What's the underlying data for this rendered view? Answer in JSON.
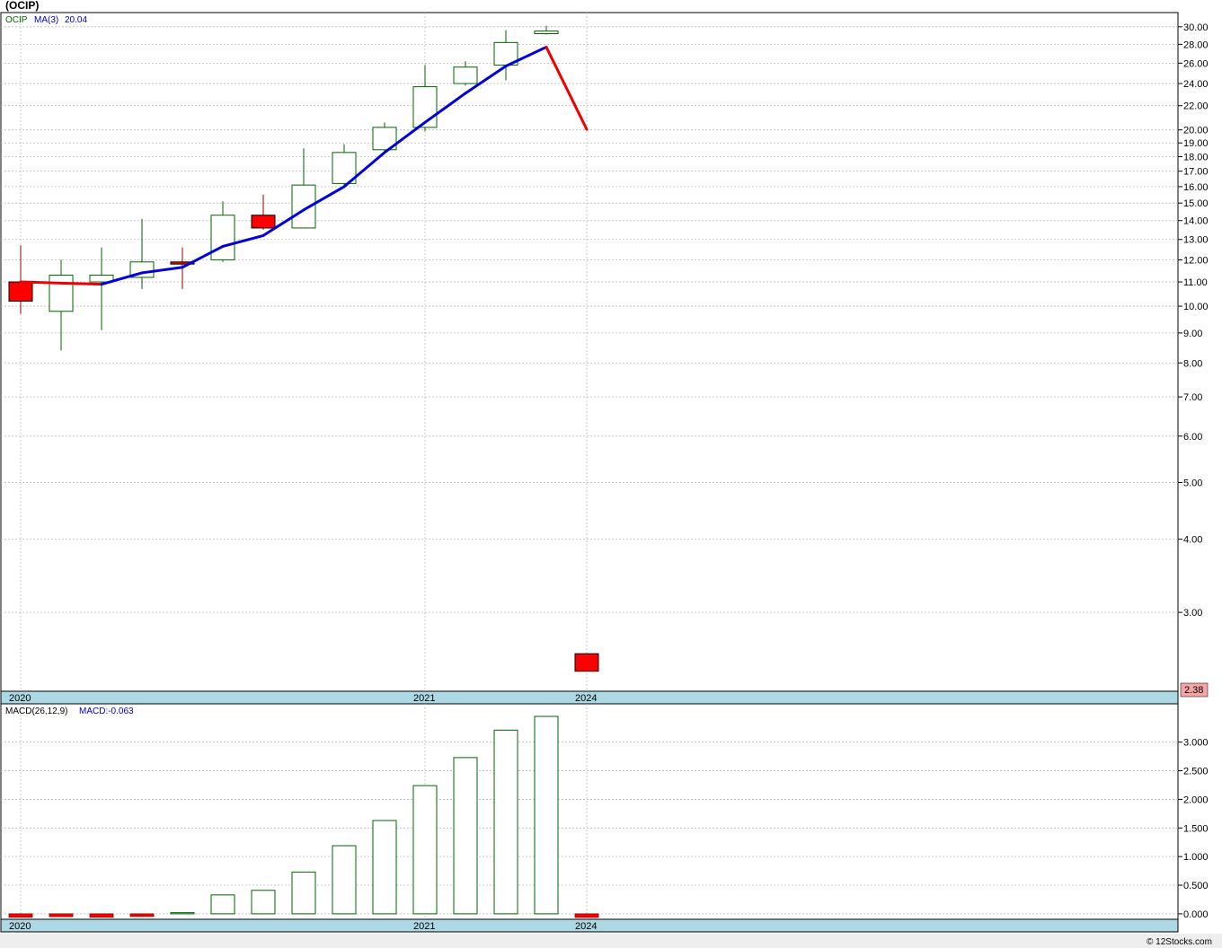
{
  "header": {
    "symbol_title": "(OCIP)"
  },
  "footer": {
    "watermark": "© 12Stocks.com"
  },
  "colors": {
    "up_border": "#006400",
    "down_fill": "#ff0000",
    "ma_up": "#0000dd",
    "ma_down": "#ee0000",
    "axis_band": "#add8e6",
    "grid": "#bbbbbb"
  },
  "chart_data": [
    {
      "type": "candlestick",
      "legend": {
        "symbol": "OCIP",
        "ma_label": "MA(3)",
        "ma_value": "20.04"
      },
      "scale": "log",
      "ylim": [
        2.2,
        31.5
      ],
      "y_ticks": [
        "30.00",
        "28.00",
        "26.00",
        "24.00",
        "22.00",
        "20.00",
        "19.00",
        "18.00",
        "17.00",
        "16.00",
        "15.00",
        "14.00",
        "13.00",
        "12.00",
        "11.00",
        "10.00",
        "9.00",
        "8.00",
        "7.00",
        "6.00",
        "5.00",
        "4.00",
        "3.00"
      ],
      "x_labels": [
        {
          "label": "2020",
          "index": 0
        },
        {
          "label": "2021",
          "index": 10
        },
        {
          "label": "2024",
          "index": 14
        }
      ],
      "last_price": "2.38",
      "candles": [
        {
          "o": 11.0,
          "h": 12.7,
          "l": 9.7,
          "c": 10.2
        },
        {
          "o": 9.8,
          "h": 12.0,
          "l": 8.4,
          "c": 11.3
        },
        {
          "o": 11.0,
          "h": 12.6,
          "l": 9.1,
          "c": 11.3
        },
        {
          "o": 11.2,
          "h": 14.1,
          "l": 10.7,
          "c": 11.9
        },
        {
          "o": 11.9,
          "h": 12.6,
          "l": 10.7,
          "c": 11.8
        },
        {
          "o": 12.0,
          "h": 15.1,
          "l": 11.9,
          "c": 14.3
        },
        {
          "o": 14.3,
          "h": 15.5,
          "l": 13.5,
          "c": 13.6
        },
        {
          "o": 13.6,
          "h": 18.6,
          "l": 13.6,
          "c": 16.1
        },
        {
          "o": 16.2,
          "h": 18.9,
          "l": 16.1,
          "c": 18.3
        },
        {
          "o": 18.5,
          "h": 20.6,
          "l": 18.3,
          "c": 20.2
        },
        {
          "o": 20.2,
          "h": 25.8,
          "l": 19.9,
          "c": 23.7
        },
        {
          "o": 24.0,
          "h": 26.2,
          "l": 23.8,
          "c": 25.6
        },
        {
          "o": 25.8,
          "h": 29.6,
          "l": 24.3,
          "c": 28.2
        },
        {
          "o": 29.2,
          "h": 30.1,
          "l": 29.1,
          "c": 29.5
        },
        {
          "o": 2.55,
          "h": 2.55,
          "l": 2.38,
          "c": 2.38
        }
      ],
      "ma": [
        11.0,
        10.95,
        10.9,
        11.4,
        11.65,
        12.65,
        13.2,
        14.6,
        16.0,
        18.3,
        20.6,
        23.1,
        25.7,
        27.7,
        20.04
      ]
    },
    {
      "type": "bar",
      "legend": {
        "name": "MACD(26,12,9)",
        "value_label": "MACD:-0.063"
      },
      "ylim": [
        -0.08,
        3.45
      ],
      "y_ticks": [
        "3.000",
        "2.500",
        "2.000",
        "1.500",
        "1.000",
        "0.500",
        "0.000"
      ],
      "x_labels": [
        {
          "label": "2020",
          "index": 0
        },
        {
          "label": "2021",
          "index": 10
        },
        {
          "label": "2024",
          "index": 14
        }
      ],
      "values": [
        -0.06,
        -0.05,
        -0.06,
        -0.02,
        0.02,
        0.33,
        0.41,
        0.73,
        1.19,
        1.63,
        2.24,
        2.73,
        3.21,
        3.45,
        -0.063
      ]
    }
  ]
}
